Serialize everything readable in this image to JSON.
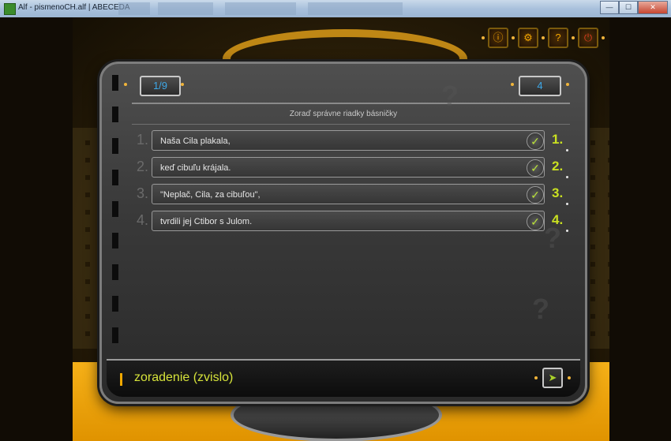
{
  "window": {
    "title": "Alf - pismenoCH.alf | ABECEDA",
    "buttons": {
      "minimize": "—",
      "maximize": "☐",
      "close": "✕"
    }
  },
  "toolbar": {
    "icons": [
      {
        "name": "info-icon",
        "glyph": "ⓘ"
      },
      {
        "name": "settings-icon",
        "glyph": "⚙"
      },
      {
        "name": "help-icon",
        "glyph": "?"
      },
      {
        "name": "exit-icon",
        "glyph": "⏻"
      }
    ]
  },
  "panel": {
    "page_counter": "1/9",
    "score": "4",
    "instruction": "Zoraď správne riadky básničky",
    "rows": [
      {
        "left_num": "1.",
        "text": "Naša Cila plakala,",
        "check": "✓",
        "right_num": "1."
      },
      {
        "left_num": "2.",
        "text": "keď cibuľu krájala.",
        "check": "✓",
        "right_num": "2."
      },
      {
        "left_num": "3.",
        "text": "\"Neplač, Cila, za cibuľou\",",
        "check": "✓",
        "right_num": "3."
      },
      {
        "left_num": "4.",
        "text": "tvrdili jej Ctibor s Julom.",
        "check": "✓",
        "right_num": "4."
      }
    ],
    "mode_label": "zoradenie (zvislo)",
    "next_glyph": "➤"
  },
  "colors": {
    "accent_orange": "#f0a800",
    "accent_green": "#c9e021",
    "counter_blue": "#3ea8e8"
  }
}
